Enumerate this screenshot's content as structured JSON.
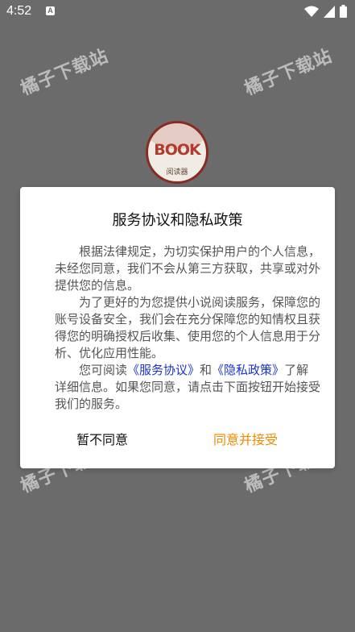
{
  "status_bar": {
    "time": "4:52",
    "notification_badge": "A",
    "icons": [
      "wifi-icon",
      "signal-icon",
      "battery-icon"
    ]
  },
  "watermarks": [
    "橘子下载站",
    "橘子下载站",
    "橘子下载站",
    "橘子下载站",
    "橘子下载站",
    "橘子下载站"
  ],
  "logo": {
    "word": "BOOK",
    "subtitle": "阅读器"
  },
  "dialog": {
    "title": "服务协议和隐私政策",
    "paragraph1": "根据法律规定，为切实保护用户的个人信息，未经您同意，我们不会从第三方获取，共享或对外提供您的信息。",
    "paragraph2": "为了更好的为您提供小说阅读服务，保障您的账号设备安全，我们会在充分保障您的知情权且获得您的明确授权后收集、使用您的个人信息用于分析、优化应用性能。",
    "paragraph3_prefix": "您可阅读",
    "service_agreement_link": "《服务协议》",
    "paragraph3_and": "和",
    "privacy_policy_link": "《隐私政策》",
    "paragraph3_suffix": "了解详细信息。如果您同意，请点击下面按钮开始接受我们的服务。",
    "decline_label": "暂不同意",
    "accept_label": "同意并接受"
  },
  "colors": {
    "background": "#6b6b6b",
    "accent": "#f08a00",
    "link": "#1a33cc"
  }
}
